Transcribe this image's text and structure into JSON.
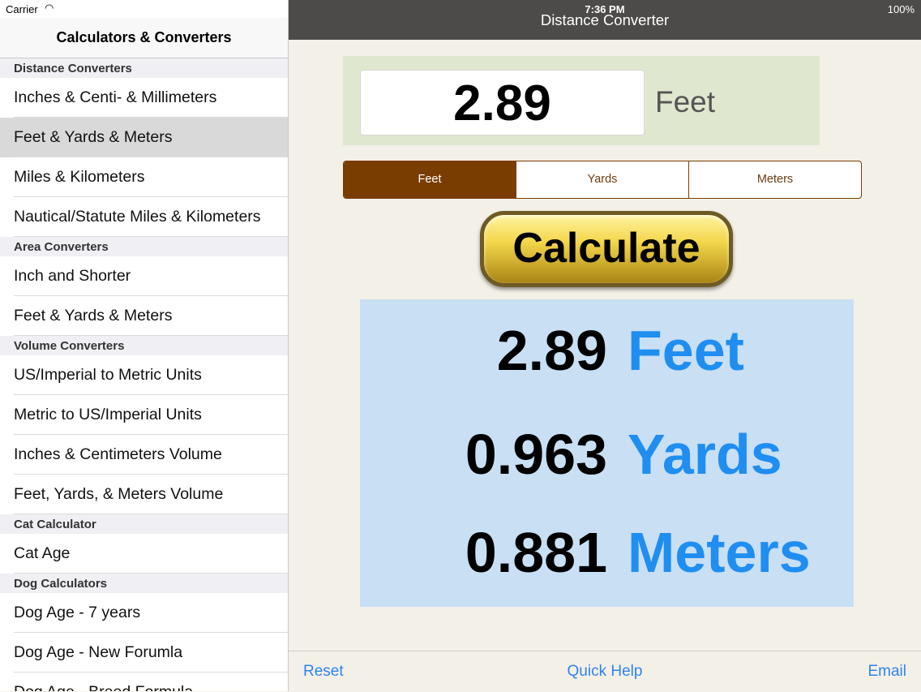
{
  "status": {
    "carrier": "Carrier",
    "time": "7:36 PM",
    "battery": "100%"
  },
  "sidebar": {
    "title": "Calculators & Converters",
    "sections": [
      {
        "header": "Distance Converters",
        "items": [
          "Inches & Centi- & Millimeters",
          "Feet & Yards & Meters",
          "Miles & Kilometers",
          "Nautical/Statute Miles & Kilometers"
        ]
      },
      {
        "header": "Area Converters",
        "items": [
          "Inch and Shorter",
          "Feet & Yards & Meters"
        ]
      },
      {
        "header": "Volume Converters",
        "items": [
          "US/Imperial to Metric Units",
          "Metric to US/Imperial Units",
          "Inches & Centimeters Volume",
          "Feet, Yards, & Meters Volume"
        ]
      },
      {
        "header": "Cat Calculator",
        "items": [
          "Cat Age"
        ]
      },
      {
        "header": "Dog Calculators",
        "items": [
          "Dog Age - 7 years",
          "Dog Age - New Forumla",
          "Dog Age - Breed Formula"
        ]
      }
    ],
    "selected": "Feet & Yards & Meters"
  },
  "main": {
    "title": "Distance Converter",
    "input_value": "2.89",
    "input_unit": "Feet",
    "segments": [
      "Feet",
      "Yards",
      "Meters"
    ],
    "active_segment": "Feet",
    "calculate_label": "Calculate",
    "results": [
      {
        "value": "2.89",
        "unit": "Feet"
      },
      {
        "value": "0.963",
        "unit": "Yards"
      },
      {
        "value": "0.881",
        "unit": "Meters"
      }
    ]
  },
  "toolbar": {
    "reset": "Reset",
    "help": "Quick Help",
    "email": "Email"
  },
  "colors": {
    "accent_brown": "#7a3d00",
    "link_blue": "#2f84e8",
    "result_unit_blue": "#1f8ef0",
    "input_panel_green": "#dfe8cf",
    "results_panel_blue": "#c9dff4"
  }
}
